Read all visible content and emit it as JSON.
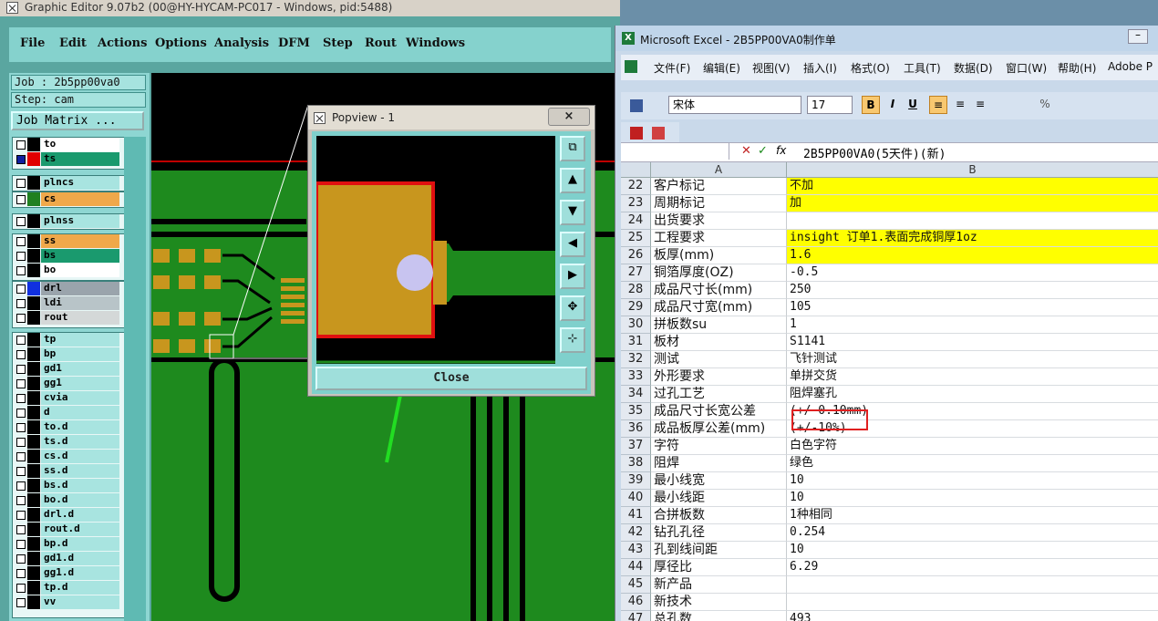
{
  "ge": {
    "title": "Graphic Editor 9.07b2 (00@HY-HYCAM-PC017 - Windows, pid:5488)",
    "menu": [
      "File",
      "Edit",
      "Actions",
      "Options",
      "Analysis",
      "DFM",
      "Step",
      "Rout",
      "Windows"
    ],
    "job": "Job : 2b5pp00va0",
    "step": "Step: cam",
    "job_matrix": "Job Matrix ...",
    "layers": [
      {
        "name": "to",
        "color": "#ffffff",
        "checked": false,
        "group": 0
      },
      {
        "name": "ts",
        "color": "#1a9a6e",
        "checked": true,
        "group": 0,
        "swatch": "#e00000"
      },
      {
        "name": "plncs",
        "color": "#a8e4e0",
        "checked": false,
        "group": 1
      },
      {
        "name": "cs",
        "color": "#f0a84a",
        "checked": false,
        "group": 2,
        "swatch": "#208020"
      },
      {
        "name": "plnss",
        "color": "#a8e4e0",
        "checked": false,
        "group": 3
      },
      {
        "name": "ss",
        "color": "#f0a84a",
        "checked": false,
        "group": 4
      },
      {
        "name": "bs",
        "color": "#1a9a6e",
        "checked": false,
        "group": 4
      },
      {
        "name": "bo",
        "color": "#ffffff",
        "checked": false,
        "group": 4
      },
      {
        "name": "drl",
        "color": "#9aa4ac",
        "checked": false,
        "group": 5,
        "swatch": "#1030e0"
      },
      {
        "name": "ldi",
        "color": "#b8c4c8",
        "checked": false,
        "group": 5
      },
      {
        "name": "rout",
        "color": "#d4d8d8",
        "checked": false,
        "group": 5
      },
      {
        "name": "tp",
        "color": "#a8e4e0",
        "checked": false,
        "group": 6
      },
      {
        "name": "bp",
        "color": "#a8e4e0",
        "checked": false,
        "group": 6
      },
      {
        "name": "gd1",
        "color": "#a8e4e0",
        "checked": false,
        "group": 6
      },
      {
        "name": "gg1",
        "color": "#a8e4e0",
        "checked": false,
        "group": 6
      },
      {
        "name": "cvia",
        "color": "#a8e4e0",
        "checked": false,
        "group": 6
      },
      {
        "name": "d",
        "color": "#a8e4e0",
        "checked": false,
        "group": 6
      },
      {
        "name": "to.d",
        "color": "#a8e4e0",
        "checked": false,
        "group": 6
      },
      {
        "name": "ts.d",
        "color": "#a8e4e0",
        "checked": false,
        "group": 6
      },
      {
        "name": "cs.d",
        "color": "#a8e4e0",
        "checked": false,
        "group": 6
      },
      {
        "name": "ss.d",
        "color": "#a8e4e0",
        "checked": false,
        "group": 6
      },
      {
        "name": "bs.d",
        "color": "#a8e4e0",
        "checked": false,
        "group": 6
      },
      {
        "name": "bo.d",
        "color": "#a8e4e0",
        "checked": false,
        "group": 6
      },
      {
        "name": "drl.d",
        "color": "#a8e4e0",
        "checked": false,
        "group": 6
      },
      {
        "name": "rout.d",
        "color": "#a8e4e0",
        "checked": false,
        "group": 6
      },
      {
        "name": "bp.d",
        "color": "#a8e4e0",
        "checked": false,
        "group": 6
      },
      {
        "name": "gd1.d",
        "color": "#a8e4e0",
        "checked": false,
        "group": 6
      },
      {
        "name": "gg1.d",
        "color": "#a8e4e0",
        "checked": false,
        "group": 6
      },
      {
        "name": "tp.d",
        "color": "#a8e4e0",
        "checked": false,
        "group": 6
      },
      {
        "name": "vv",
        "color": "#a8e4e0",
        "checked": false,
        "group": 6
      }
    ]
  },
  "popview": {
    "title": "Popview - 1",
    "close_x": "×",
    "close": "Close"
  },
  "excel": {
    "title": "Microsoft Excel - 2B5PP00VA0制作单",
    "menu": [
      "文件(F)",
      "编辑(E)",
      "视图(V)",
      "插入(I)",
      "格式(O)",
      "工具(T)",
      "数据(D)",
      "窗口(W)",
      "帮助(H)",
      "Adobe P"
    ],
    "font_name": "宋体",
    "font_size": "17",
    "formula": "2B5PP00VA0(5天件)(新)",
    "col_a": "A",
    "col_b": "B",
    "rows": [
      {
        "n": "22",
        "a": "客户标记",
        "b": "不加",
        "hl": true
      },
      {
        "n": "23",
        "a": "周期标记",
        "b": "加",
        "hl": true
      },
      {
        "n": "24",
        "a": "出货要求",
        "b": "",
        "hl": false
      },
      {
        "n": "25",
        "a": "工程要求",
        "b": "insight 订单1.表面完成铜厚1oz",
        "hl": true
      },
      {
        "n": "26",
        "a": "板厚(mm)",
        "b": "1.6",
        "hl": true
      },
      {
        "n": "27",
        "a": "铜箔厚度(OZ)",
        "b": "-0.5",
        "hl": false
      },
      {
        "n": "28",
        "a": "成品尺寸长(mm)",
        "b": "250",
        "hl": false
      },
      {
        "n": "29",
        "a": "成品尺寸宽(mm)",
        "b": "105",
        "hl": false
      },
      {
        "n": "30",
        "a": "拼板数su",
        "b": "1",
        "hl": false
      },
      {
        "n": "31",
        "a": "板材",
        "b": "S1141",
        "hl": false
      },
      {
        "n": "32",
        "a": "测试",
        "b": "飞针测试",
        "hl": false
      },
      {
        "n": "33",
        "a": "外形要求",
        "b": "单拼交货",
        "hl": false
      },
      {
        "n": "34",
        "a": "过孔工艺",
        "b": "阻焊塞孔",
        "hl": false
      },
      {
        "n": "35",
        "a": "成品尺寸长宽公差",
        "b": "(+/-0.10mm)",
        "hl": false
      },
      {
        "n": "36",
        "a": "成品板厚公差(mm)",
        "b": "(+/-10%)",
        "hl": false
      },
      {
        "n": "37",
        "a": "字符",
        "b": "白色字符",
        "hl": false
      },
      {
        "n": "38",
        "a": "阻焊",
        "b": "绿色",
        "hl": false
      },
      {
        "n": "39",
        "a": "最小线宽",
        "b": "10",
        "hl": false
      },
      {
        "n": "40",
        "a": "最小线距",
        "b": "10",
        "hl": false
      },
      {
        "n": "41",
        "a": "合拼板数",
        "b": "1种相同",
        "hl": false
      },
      {
        "n": "42",
        "a": "钻孔孔径",
        "b": "0.254",
        "hl": false
      },
      {
        "n": "43",
        "a": "孔到线间距",
        "b": "10",
        "hl": false
      },
      {
        "n": "44",
        "a": "厚径比",
        "b": "6.29",
        "hl": false
      },
      {
        "n": "45",
        "a": "新产品",
        "b": "",
        "hl": false
      },
      {
        "n": "46",
        "a": "新技术",
        "b": "",
        "hl": false
      },
      {
        "n": "47",
        "a": "总孔数",
        "b": "493",
        "hl": false
      }
    ]
  }
}
